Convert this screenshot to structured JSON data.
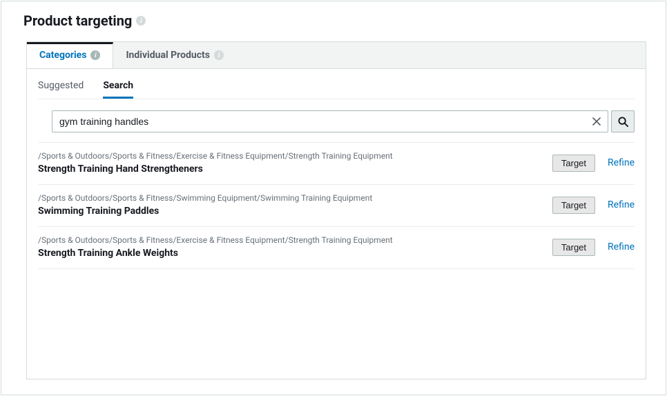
{
  "header": {
    "title": "Product targeting"
  },
  "tabs": {
    "categories": "Categories",
    "individual": "Individual Products"
  },
  "subtabs": {
    "suggested": "Suggested",
    "search": "Search"
  },
  "search": {
    "value": "gym training handles"
  },
  "buttons": {
    "target": "Target",
    "refine": "Refine"
  },
  "results": [
    {
      "path": "/Sports & Outdoors/Sports & Fitness/Exercise & Fitness Equipment/Strength Training Equipment",
      "name": "Strength Training Hand Strengtheners"
    },
    {
      "path": "/Sports & Outdoors/Sports & Fitness/Swimming Equipment/Swimming Training Equipment",
      "name": "Swimming Training Paddles"
    },
    {
      "path": "/Sports & Outdoors/Sports & Fitness/Exercise & Fitness Equipment/Strength Training Equipment",
      "name": "Strength Training Ankle Weights"
    }
  ]
}
